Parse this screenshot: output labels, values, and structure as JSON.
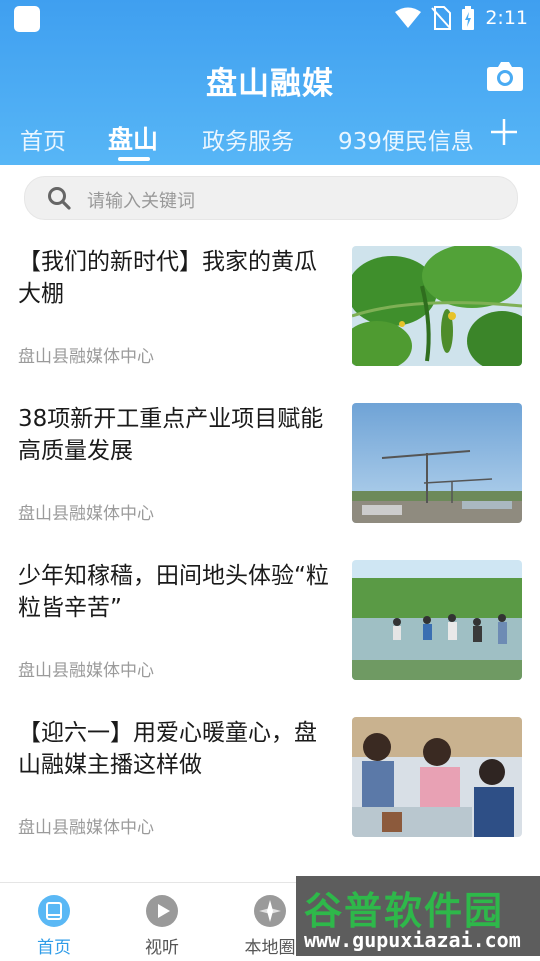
{
  "status_bar": {
    "time": "2:11"
  },
  "app": {
    "title": "盘山融媒"
  },
  "tabs": [
    {
      "label": "首页",
      "active": false
    },
    {
      "label": "盘山",
      "active": true
    },
    {
      "label": "政务服务",
      "active": false
    },
    {
      "label": "939便民信息",
      "active": false
    }
  ],
  "search": {
    "placeholder": "请输入关键词"
  },
  "articles": [
    {
      "title": "【我们的新时代】我家的黄瓜大棚",
      "source": "盘山县融媒体中心",
      "image": "cucumber-plants"
    },
    {
      "title": "38项新开工重点产业项目赋能高质量发展",
      "source": "盘山县融媒体中心",
      "image": "construction-cranes"
    },
    {
      "title": "少年知稼穑，田间地头体验“粒粒皆辛苦”",
      "source": "盘山县融媒体中心",
      "image": "children-in-rice-field"
    },
    {
      "title": "【迎六一】用爱心暖童心，盘山融媒主播这样做",
      "source": "盘山县融媒体中心",
      "image": "children-at-table"
    }
  ],
  "bottom_nav": [
    {
      "label": "首页",
      "icon": "home-icon",
      "active": true
    },
    {
      "label": "视听",
      "icon": "play-icon",
      "active": false
    },
    {
      "label": "本地圈",
      "icon": "compass-icon",
      "active": false
    }
  ],
  "watermark": {
    "title": "谷普软件园",
    "url": "www.gupuxiazai.com"
  },
  "colors": {
    "header": "#4aabf3",
    "active_nav": "#2f9ce8",
    "source_text": "#9b9b9b"
  }
}
